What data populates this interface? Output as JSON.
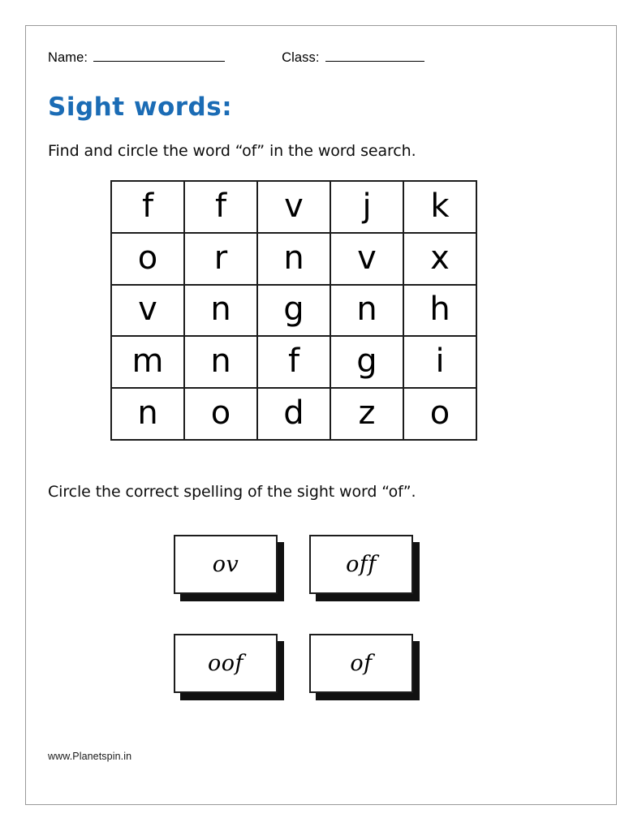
{
  "page": {
    "title": "Sight words:",
    "title_color": "#1b6cb5",
    "border_color": "#9a9a9a"
  },
  "header": {
    "name_label": "Name:",
    "name_value": "",
    "class_label": "Class:",
    "class_value": ""
  },
  "instructions": {
    "word_search": "Find and circle the word “of” in the word search.",
    "spelling": "Circle the correct spelling of the sight word “of”."
  },
  "word_search": {
    "rows": 5,
    "cols": 5,
    "target_word": "of",
    "letters": [
      [
        "f",
        "f",
        "v",
        "j",
        "k"
      ],
      [
        "o",
        "r",
        "n",
        "v",
        "x"
      ],
      [
        "v",
        "n",
        "g",
        "n",
        "h"
      ],
      [
        "m",
        "n",
        "f",
        "g",
        "i"
      ],
      [
        "n",
        "o",
        "d",
        "z",
        "o"
      ]
    ],
    "letters_flat": [
      "f",
      "f",
      "v",
      "j",
      "k",
      "o",
      "r",
      "n",
      "v",
      "x",
      "v",
      "n",
      "g",
      "n",
      "h",
      "m",
      "n",
      "f",
      "g",
      "i",
      "n",
      "o",
      "d",
      "z",
      "o"
    ]
  },
  "spelling_choices": [
    {
      "label": "ov",
      "correct": false
    },
    {
      "label": "off",
      "correct": false
    },
    {
      "label": "oof",
      "correct": false
    },
    {
      "label": "of",
      "correct": true
    }
  ],
  "footer": {
    "website": "www.Planetspin.in"
  }
}
